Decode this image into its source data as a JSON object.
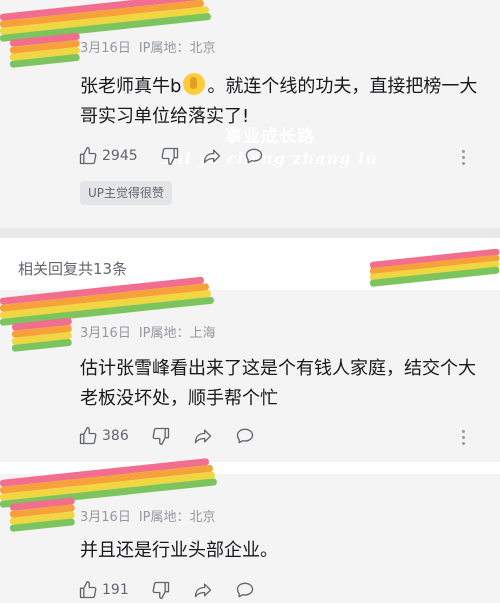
{
  "comments": [
    {
      "date": "3月16日",
      "ip": "IP属地：北京",
      "text_before": "张老师真牛b",
      "text_after": "。就连个线的功夫，直接把榜一大哥实习单位给落实了!",
      "likes": "2945",
      "badge": "UP主觉得很赞"
    },
    {
      "date": "3月16日",
      "ip": "IP属地：上海",
      "text": "估计张雪峰看出来了这是个有钱人家庭，结交个大老板没坏处，顺手帮个忙",
      "likes": "386"
    },
    {
      "date": "3月16日",
      "ip": "IP属地：北京",
      "text": "并且还是行业头部企业。",
      "likes": "191"
    }
  ],
  "replies_header": "相关回复共13条",
  "watermark": {
    "line1": "事业成长路",
    "line2": "shi ye cheng zhang lu"
  },
  "icons": {
    "like": "thumbs-up-icon",
    "dislike": "thumbs-down-icon",
    "share": "share-icon",
    "reply": "comment-icon",
    "more": "more-vertical-icon",
    "emoji": "thumbs-up-emoji"
  },
  "colors": {
    "stripe_pink": "#f26e8f",
    "stripe_orange": "#f6a13a",
    "stripe_yellow": "#f0d640",
    "stripe_green": "#7cc45d"
  }
}
